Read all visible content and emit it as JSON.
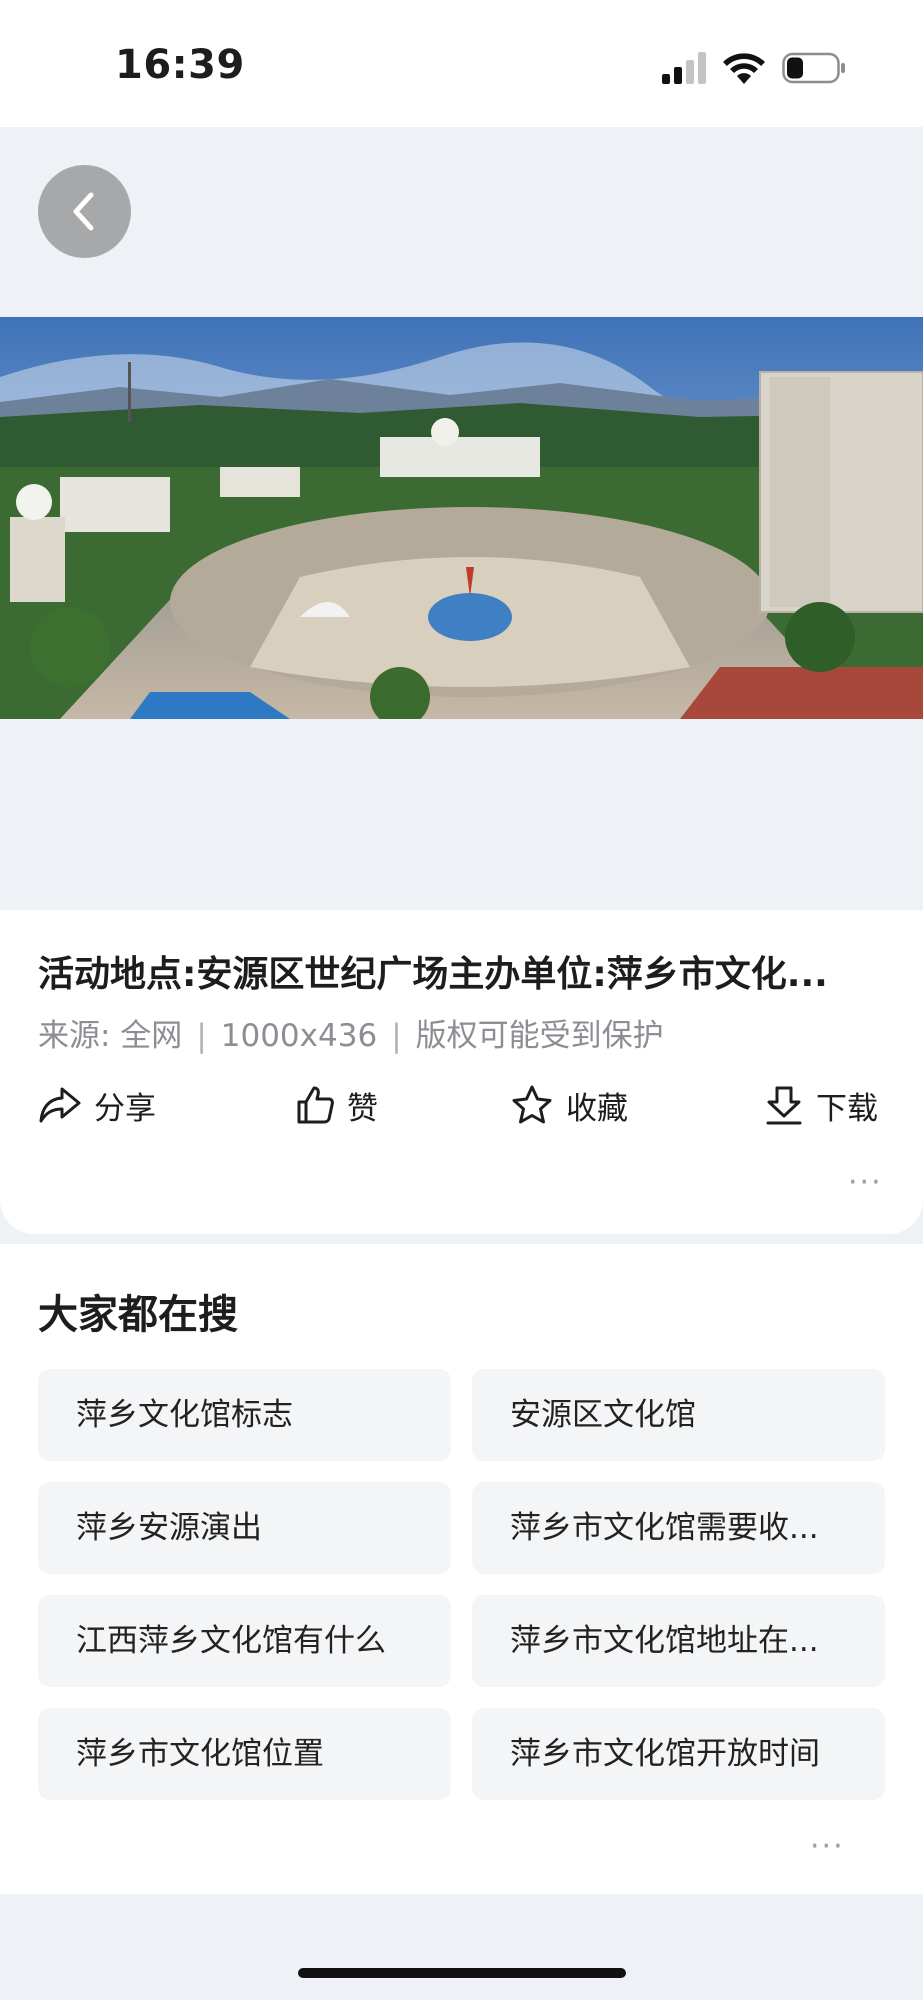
{
  "status_bar": {
    "time": "16:39",
    "battery_level": 0.3
  },
  "image": {
    "description_icon": "city-square-photo"
  },
  "info": {
    "title": "活动地点:安源区世纪广场主办单位:萍乡市文化...",
    "source": "来源: 全网",
    "size": "1000x436",
    "copyright": "版权可能受到保护"
  },
  "actions": {
    "share": "分享",
    "like": "赞",
    "favorite": "收藏",
    "download": "下载"
  },
  "search": {
    "title": "大家都在搜",
    "items": [
      "萍乡文化馆标志",
      "安源区文化馆",
      "萍乡安源演出",
      "萍乡市文化馆需要收...",
      "江西萍乡文化馆有什么",
      "萍乡市文化馆地址在...",
      "萍乡市文化馆位置",
      "萍乡市文化馆开放时间"
    ]
  },
  "more_label": "···"
}
